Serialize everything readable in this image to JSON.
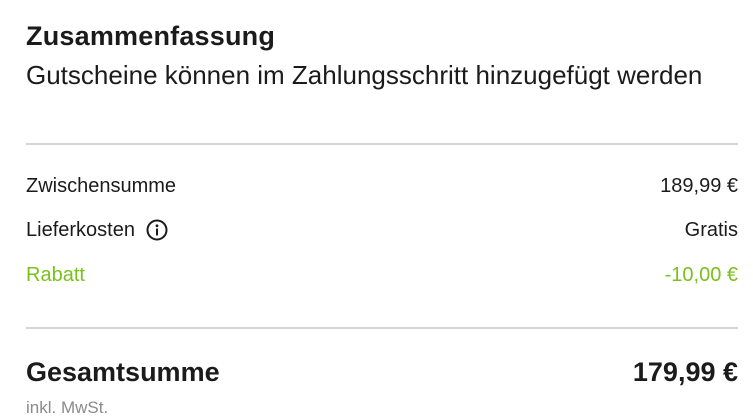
{
  "summary": {
    "title": "Zusammenfassung",
    "subtitle": "Gutscheine können im Zahlungsschritt hinzugefügt werden",
    "rows": [
      {
        "label": "Zwischensumme",
        "value": "189,99 €"
      },
      {
        "label": "Lieferkosten",
        "value": "Gratis",
        "icon": "info-icon"
      },
      {
        "label": "Rabatt",
        "value": "-10,00 €"
      }
    ],
    "total": {
      "label": "Gesamtsumme",
      "value": "179,99 €"
    },
    "vat_note": "inkl. MwSt."
  },
  "colors": {
    "text": "#1b1b1b",
    "discount": "#78c21a",
    "divider": "#d4d4d4",
    "muted": "#8a8a8a"
  }
}
